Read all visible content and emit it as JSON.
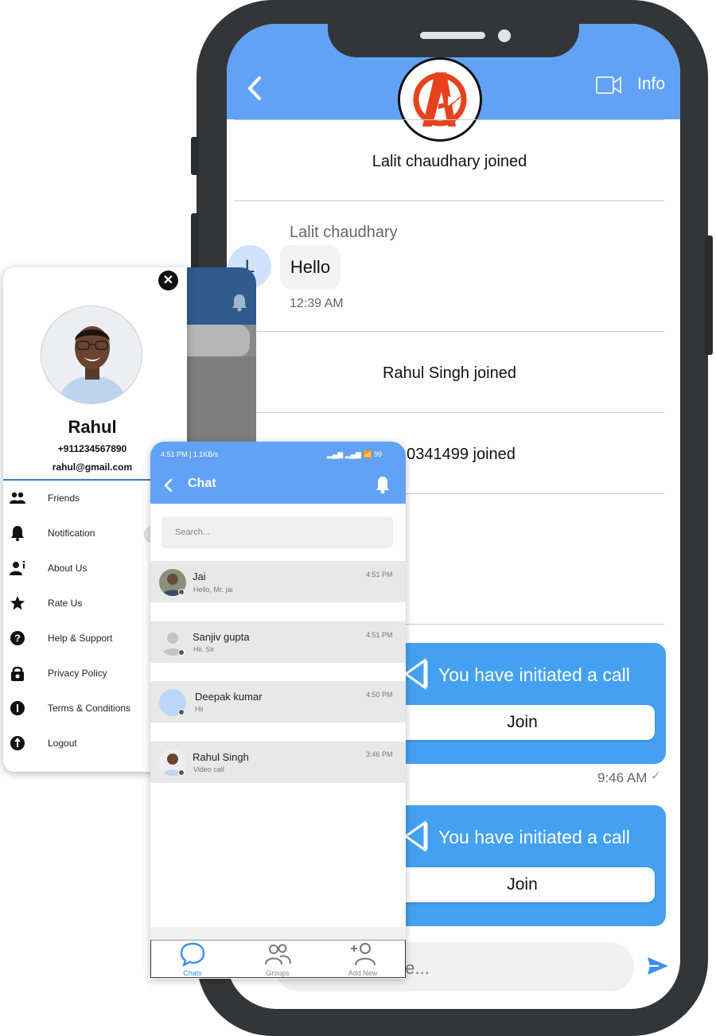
{
  "colors": {
    "accent": "#62a2f5",
    "call_card": "#44a1f1",
    "drawer_divider": "#3a7bd5",
    "frame": "#333638"
  },
  "chat": {
    "header_info": "Info",
    "events": [
      {
        "text": "Lalit chaudhary joined"
      },
      {
        "text": "Rahul Singh joined"
      },
      {
        "text": "10341499 joined"
      }
    ],
    "message": {
      "sender": "Lalit chaudhary",
      "avatar_letter": "L",
      "text": "Hello",
      "time": "12:39 AM"
    },
    "calls": [
      {
        "title": "You have initiated a call",
        "button": "Join"
      },
      {
        "title": "You have initiated a call",
        "button": "Join"
      }
    ],
    "call_time": "9:46 AM",
    "check": "✓",
    "input_placeholder": "ge...",
    "icons": [
      "back-chevron-icon",
      "avengers-logo",
      "video-camera-icon",
      "send-icon"
    ]
  },
  "drawer": {
    "close": "✕",
    "name": "Rahul",
    "phone": "+911234567890",
    "email": "rahul@gmail.com",
    "menu": [
      {
        "label": "Friends",
        "icon": "friends-icon"
      },
      {
        "label": "Notification",
        "icon": "bell-icon"
      },
      {
        "label": "About Us",
        "icon": "about-icon"
      },
      {
        "label": "Rate Us",
        "icon": "star-icon"
      },
      {
        "label": "Help & Support",
        "icon": "help-icon"
      },
      {
        "label": "Privacy Policy",
        "icon": "lock-icon"
      },
      {
        "label": "Terms & Conditions",
        "icon": "info-icon"
      },
      {
        "label": "Logout",
        "icon": "logout-icon"
      }
    ]
  },
  "small": {
    "status_time": "4:51 PM | 1.1KB/s",
    "status_right": "▂▄▆ ▂▄▆ 📶 99",
    "title": "Chat",
    "search_placeholder": "Search...",
    "chats": [
      {
        "name": "Jai",
        "preview": "Hello, Mr. jai",
        "time": "4:51 PM"
      },
      {
        "name": "Sanjiv gupta",
        "preview": "Hii. Sir",
        "time": "4:51 PM"
      },
      {
        "name": "Deepak kumar",
        "preview": "Hii",
        "time": "4:50 PM"
      },
      {
        "name": "Rahul Singh",
        "preview": "Video call",
        "time": "3:46 PM"
      }
    ],
    "nav": [
      {
        "label": "Chats",
        "icon": "chats-icon"
      },
      {
        "label": "Groups",
        "icon": "groups-icon"
      },
      {
        "label": "Add New",
        "icon": "add-user-icon"
      }
    ]
  }
}
